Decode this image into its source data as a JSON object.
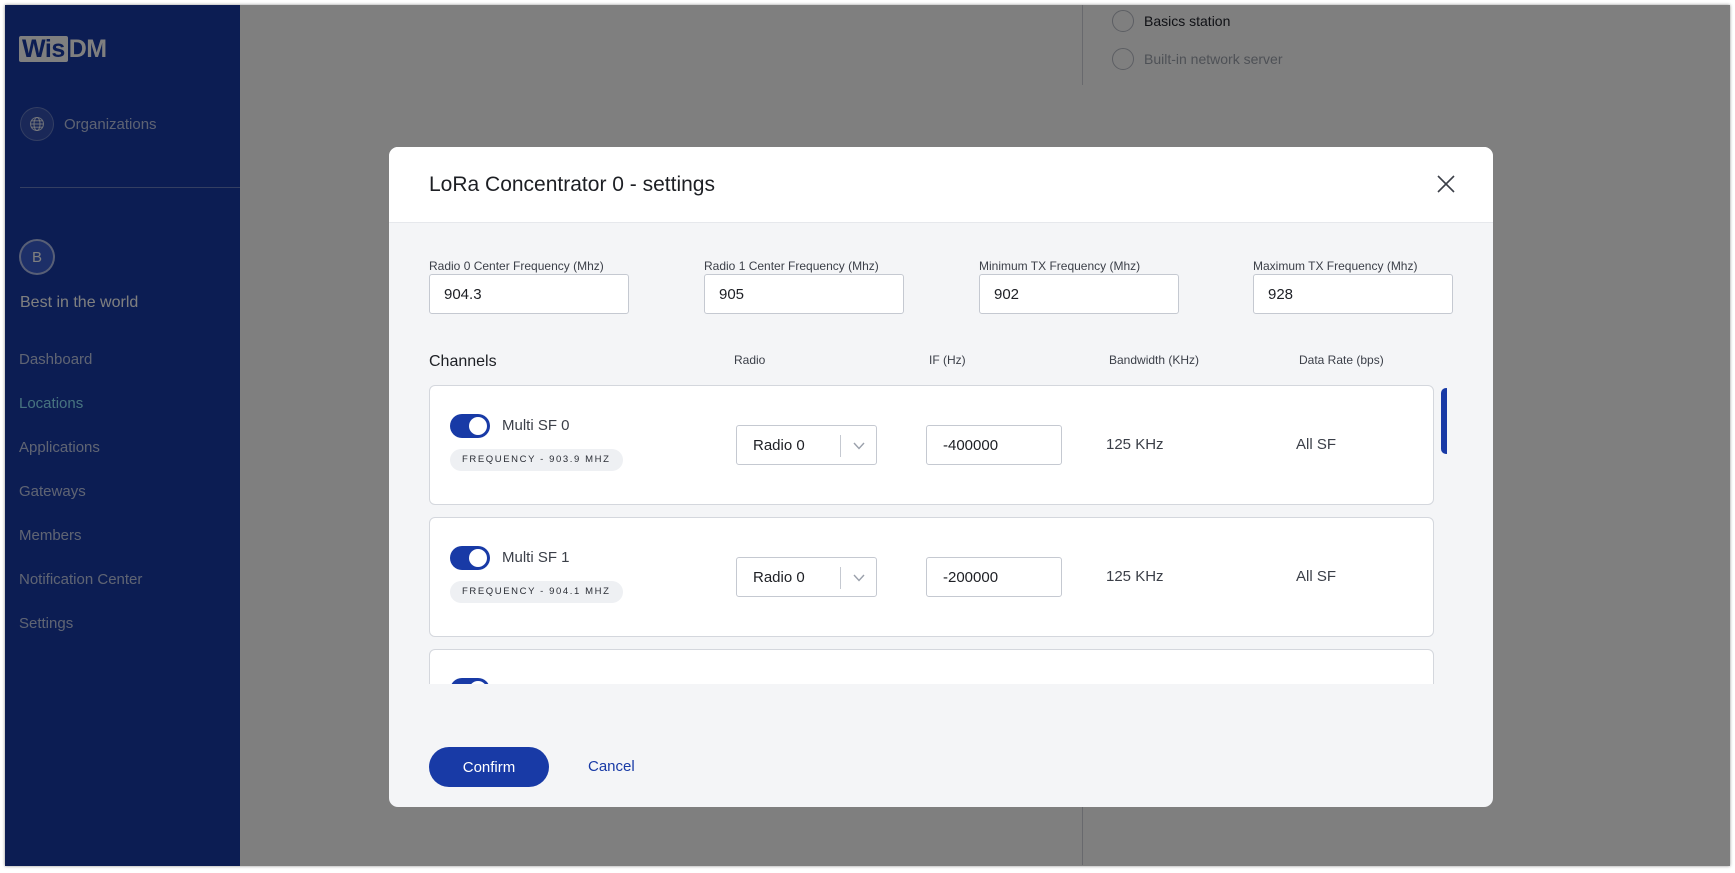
{
  "sidebar": {
    "logo": {
      "part1": "Wis",
      "part2": "DM"
    },
    "organizations_label": "Organizations",
    "avatar_letter": "B",
    "org_name": "Best in the world",
    "nav": [
      {
        "label": "Dashboard",
        "active": false
      },
      {
        "label": "Locations",
        "active": true
      },
      {
        "label": "Applications",
        "active": false
      },
      {
        "label": "Gateways",
        "active": false
      },
      {
        "label": "Members",
        "active": false
      },
      {
        "label": "Notification Center",
        "active": false
      },
      {
        "label": "Settings",
        "active": false
      }
    ]
  },
  "background": {
    "options": [
      "Basics station",
      "Built-in network server"
    ]
  },
  "modal": {
    "title": "LoRa Concentrator 0 - settings",
    "fields": [
      {
        "label": "Radio 0 Center Frequency (Mhz)",
        "value": "904.3"
      },
      {
        "label": "Radio 1 Center Frequency (Mhz)",
        "value": "905"
      },
      {
        "label": "Minimum TX Frequency (Mhz)",
        "value": "902"
      },
      {
        "label": "Maximum TX Frequency (Mhz)",
        "value": "928"
      }
    ],
    "channels_title": "Channels",
    "columns": {
      "radio": "Radio",
      "if": "IF (Hz)",
      "bandwidth": "Bandwidth (KHz)",
      "data_rate": "Data Rate (bps)"
    },
    "channels": [
      {
        "name": "Multi SF 0",
        "enabled": true,
        "frequency": "FREQUENCY - 903.9 MHZ",
        "radio": "Radio 0",
        "if": "-400000",
        "bandwidth": "125 KHz",
        "data_rate": "All SF"
      },
      {
        "name": "Multi SF 1",
        "enabled": true,
        "frequency": "FREQUENCY - 904.1 MHZ",
        "radio": "Radio 0",
        "if": "-200000",
        "bandwidth": "125 KHz",
        "data_rate": "All SF"
      },
      {
        "name": "",
        "enabled": true,
        "frequency": "",
        "radio": "",
        "if": "",
        "bandwidth": "",
        "data_rate": ""
      }
    ],
    "confirm_label": "Confirm",
    "cancel_label": "Cancel"
  },
  "colors": {
    "brand": "#183aa6",
    "active_nav": "#8ee6ff",
    "overlay": "rgba(0,0,0,0.5)"
  }
}
